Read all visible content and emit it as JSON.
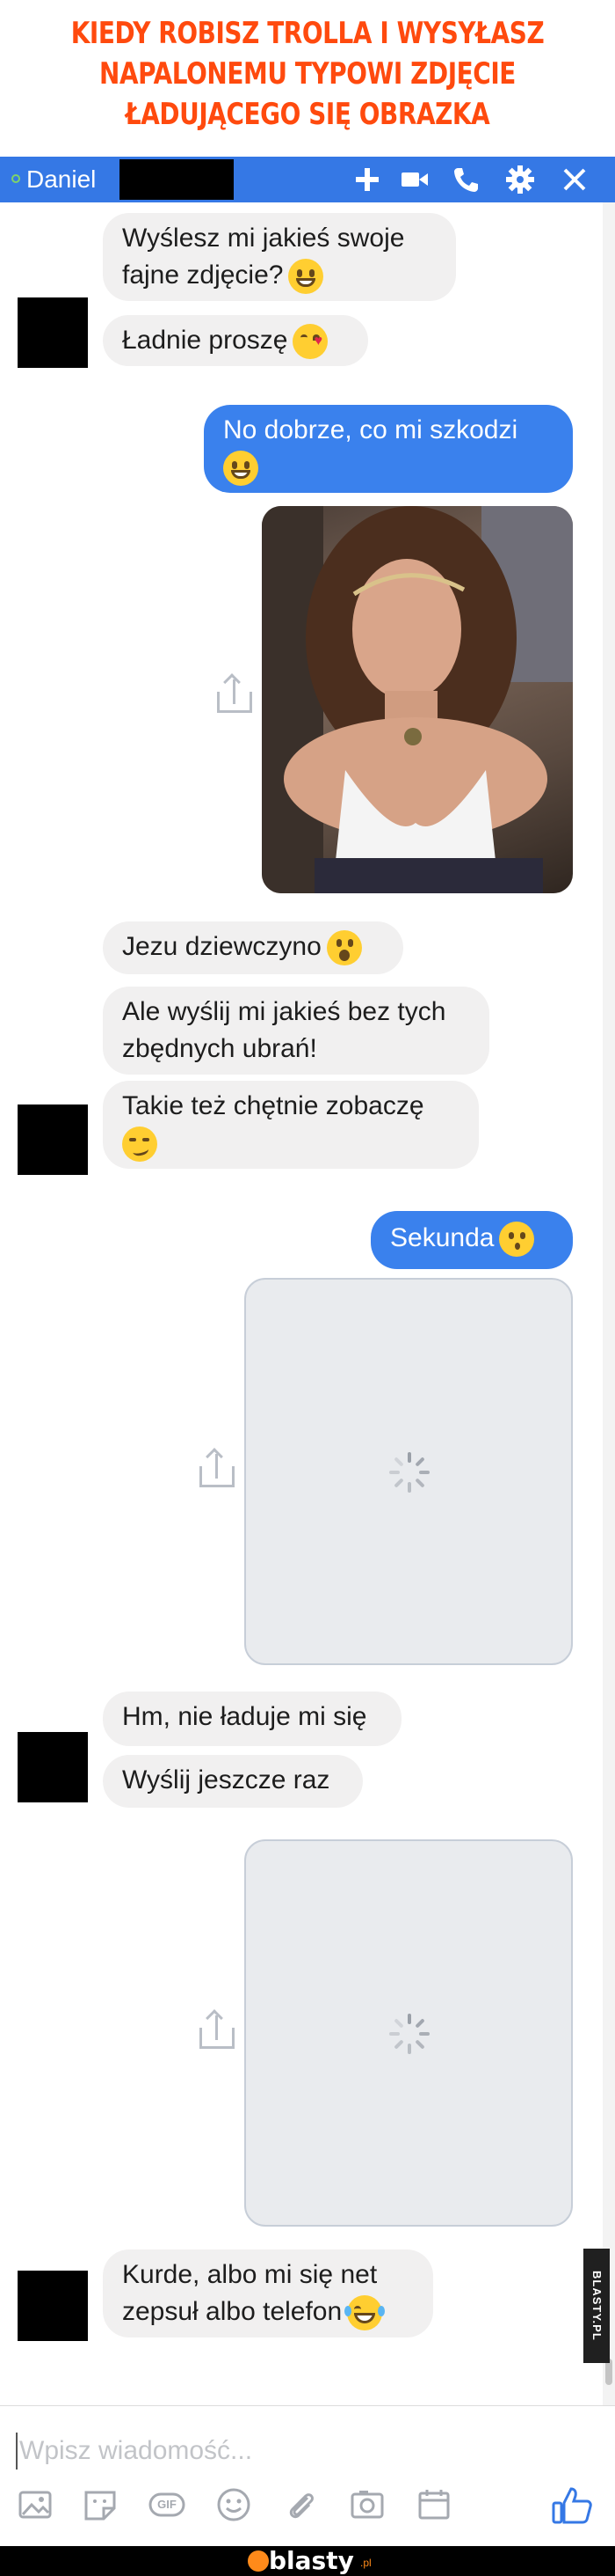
{
  "title": {
    "line1": "KIEDY ROBISZ TROLLA I WYSYŁASZ",
    "line2": "NAPALONEMU TYPOWI ZDJĘCIE",
    "line3": "ŁADUJĄCEGO SIĘ OBRAZKA"
  },
  "header": {
    "contact_name": "Daniel",
    "status": "online",
    "icons": [
      "plus-icon",
      "video-camera-icon",
      "phone-icon",
      "gear-icon",
      "close-icon"
    ],
    "accent_color": "#3578e5"
  },
  "messages": {
    "m1": "Wyślesz mi jakieś swoje fajne zdjęcie?",
    "m2": "Ładnie proszę",
    "m3": "No dobrze, co mi szkodzi",
    "m4": "Jezu dziewczyno",
    "m5": "Ale wyślij mi jakieś bez tych zbędnych ubrań!",
    "m6": "Takie też chętnie zobaczę",
    "m7": "Sekunda",
    "m8": "Hm, nie ładuje mi się",
    "m9": "Wyślij jeszcze raz",
    "m10": "Kurde, albo mi się net zepsuł albo telefon"
  },
  "emojis": [
    "grin",
    "kiss-heart",
    "grin",
    "astonished",
    "smirk",
    "kissing",
    "tears-of-joy"
  ],
  "composer": {
    "placeholder": "Wpisz wiadomość...",
    "tools": [
      "image-icon",
      "sticker-icon",
      "gif-icon",
      "emoji-icon",
      "attach-icon",
      "camera-icon",
      "calendar-icon"
    ],
    "gif_label": "GIF",
    "like_icon": "thumbs-up-icon"
  },
  "footer": {
    "brand": "blasty",
    "tld": ".pl"
  },
  "watermark": "BLASTY.PL"
}
